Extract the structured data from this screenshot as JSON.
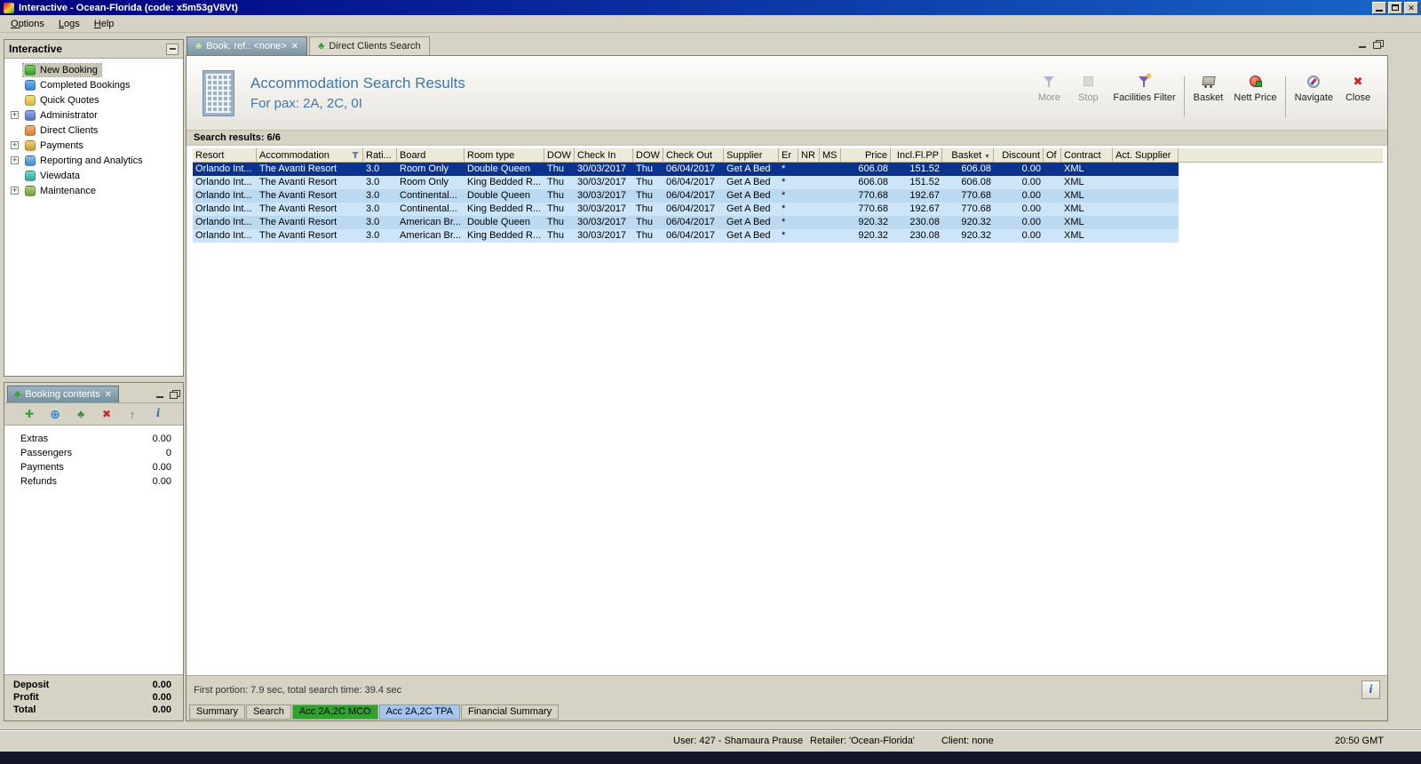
{
  "window": {
    "title": "Interactive - Ocean-Florida (code: x5m53gV8Vt)"
  },
  "menu": {
    "items": [
      "Options",
      "Logs",
      "Help"
    ]
  },
  "sidebar": {
    "title": "Interactive",
    "items": [
      {
        "label": "New Booking",
        "icon": "new-booking-icon",
        "expandable": false,
        "selected": true
      },
      {
        "label": "Completed Bookings",
        "icon": "completed-bookings-icon",
        "expandable": false,
        "selected": false
      },
      {
        "label": "Quick Quotes",
        "icon": "quick-quotes-icon",
        "expandable": false,
        "selected": false
      },
      {
        "label": "Administrator",
        "icon": "administrator-icon",
        "expandable": true,
        "selected": false
      },
      {
        "label": "Direct Clients",
        "icon": "direct-clients-icon",
        "expandable": false,
        "selected": false
      },
      {
        "label": "Payments",
        "icon": "payments-icon",
        "expandable": true,
        "selected": false
      },
      {
        "label": "Reporting and Analytics",
        "icon": "reporting-icon",
        "expandable": true,
        "selected": false
      },
      {
        "label": "Viewdata",
        "icon": "viewdata-icon",
        "expandable": false,
        "selected": false
      },
      {
        "label": "Maintenance",
        "icon": "maintenance-icon",
        "expandable": true,
        "selected": false
      }
    ]
  },
  "booking_contents": {
    "title": "Booking contents",
    "toolbar_icons": [
      "add-icon",
      "world-icon",
      "export-icon",
      "delete-icon",
      "import-icon",
      "info-icon"
    ],
    "rows": [
      {
        "label": "Extras",
        "value": "0.00"
      },
      {
        "label": "Passengers",
        "value": "0"
      },
      {
        "label": "Payments",
        "value": "0.00"
      },
      {
        "label": "Refunds",
        "value": "0.00"
      }
    ],
    "totals": [
      {
        "label": "Deposit",
        "value": "0.00"
      },
      {
        "label": "Profit",
        "value": "0.00"
      },
      {
        "label": "Total",
        "value": "0.00"
      }
    ]
  },
  "workspace": {
    "tabs": [
      {
        "label": "Book. ref.: <none>",
        "active": true,
        "closable": true
      },
      {
        "label": "Direct Clients Search",
        "active": false,
        "closable": false
      }
    ],
    "header": {
      "title": "Accommodation Search Results",
      "subtitle": "For pax: 2A, 2C, 0I"
    },
    "toolbar_groups": [
      {
        "buttons": [
          {
            "label": "More",
            "icon": "more-icon",
            "disabled": true
          },
          {
            "label": "Stop",
            "icon": "stop-icon",
            "disabled": true
          },
          {
            "label": "Facilities Filter",
            "icon": "facilities-filter-icon",
            "disabled": false
          }
        ]
      },
      {
        "buttons": [
          {
            "label": "Basket",
            "icon": "basket-icon",
            "disabled": false
          },
          {
            "label": "Nett Price",
            "icon": "nett-price-icon",
            "disabled": false
          }
        ]
      },
      {
        "buttons": [
          {
            "label": "Navigate",
            "icon": "navigate-icon",
            "disabled": false
          },
          {
            "label": "Close",
            "icon": "close-icon",
            "disabled": false
          }
        ]
      }
    ],
    "results_summary": "Search results: 6/6",
    "search_status": "First portion: 7.9 sec, total search time: 39.4 sec",
    "bottom_tabs": [
      {
        "label": "Summary",
        "style": "plain"
      },
      {
        "label": "Search",
        "style": "plain"
      },
      {
        "label": "Acc 2A,2C MCO",
        "style": "green"
      },
      {
        "label": "Acc 2A,2C TPA",
        "style": "blue"
      },
      {
        "label": "Financial Summary",
        "style": "plain"
      }
    ]
  },
  "table": {
    "columns": [
      "Resort",
      "Accommodation",
      "Rati...",
      "Board",
      "Room type",
      "DOW",
      "Check In",
      "DOW",
      "Check Out",
      "Supplier",
      "Er",
      "NR",
      "MS",
      "Price",
      "Incl.Fl.PP",
      "Basket",
      "Discount",
      "Of",
      "Contract",
      "Act. Supplier"
    ],
    "selected_row": 0,
    "rows": [
      [
        "Orlando Int...",
        "The Avanti Resort",
        "3.0",
        "Room Only",
        "Double Queen",
        "Thu",
        "30/03/2017",
        "Thu",
        "06/04/2017",
        "Get A Bed",
        "*",
        "",
        "",
        "606.08",
        "151.52",
        "606.08",
        "0.00",
        "",
        "XML",
        ""
      ],
      [
        "Orlando Int...",
        "The Avanti Resort",
        "3.0",
        "Room Only",
        "King Bedded R...",
        "Thu",
        "30/03/2017",
        "Thu",
        "06/04/2017",
        "Get A Bed",
        "*",
        "",
        "",
        "606.08",
        "151.52",
        "606.08",
        "0.00",
        "",
        "XML",
        ""
      ],
      [
        "Orlando Int...",
        "The Avanti Resort",
        "3.0",
        "Continental...",
        "Double Queen",
        "Thu",
        "30/03/2017",
        "Thu",
        "06/04/2017",
        "Get A Bed",
        "*",
        "",
        "",
        "770.68",
        "192.67",
        "770.68",
        "0.00",
        "",
        "XML",
        ""
      ],
      [
        "Orlando Int...",
        "The Avanti Resort",
        "3.0",
        "Continental...",
        "King Bedded R...",
        "Thu",
        "30/03/2017",
        "Thu",
        "06/04/2017",
        "Get A Bed",
        "*",
        "",
        "",
        "770.68",
        "192.67",
        "770.68",
        "0.00",
        "",
        "XML",
        ""
      ],
      [
        "Orlando Int...",
        "The Avanti Resort",
        "3.0",
        "American Br...",
        "Double Queen",
        "Thu",
        "30/03/2017",
        "Thu",
        "06/04/2017",
        "Get A Bed",
        "*",
        "",
        "",
        "920.32",
        "230.08",
        "920.32",
        "0.00",
        "",
        "XML",
        ""
      ],
      [
        "Orlando Int...",
        "The Avanti Resort",
        "3.0",
        "American Br...",
        "King Bedded R...",
        "Thu",
        "30/03/2017",
        "Thu",
        "06/04/2017",
        "Get A Bed",
        "*",
        "",
        "",
        "920.32",
        "230.08",
        "920.32",
        "0.00",
        "",
        "XML",
        ""
      ]
    ]
  },
  "statusbar": {
    "user": "User: 427 - Shamaura Prause",
    "retailer": "Retailer: 'Ocean-Florida'",
    "client": "Client: none",
    "time": "20:50 GMT"
  }
}
